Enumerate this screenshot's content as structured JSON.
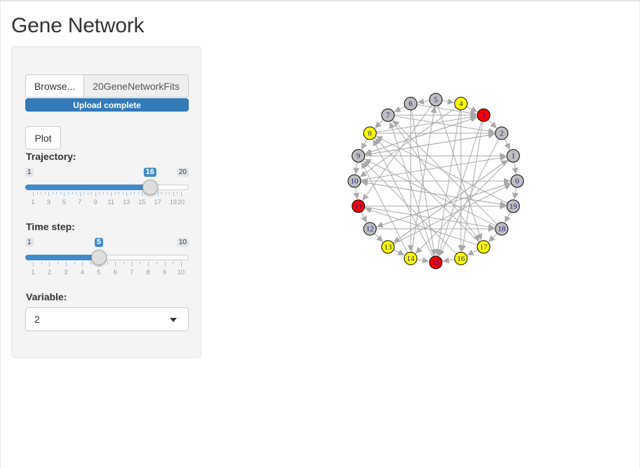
{
  "app_title": "Gene Network",
  "sidebar": {
    "file_input": {
      "browse_label": "Browse...",
      "file_name": "20GeneNetworkFits",
      "upload_status": "Upload complete",
      "upload_progress_percent": 100
    },
    "plot_button_label": "Plot",
    "trajectory": {
      "label": "Trajectory:",
      "min": 1,
      "max": 20,
      "value": 16,
      "min_label": "1",
      "max_label": "20",
      "value_label": "16",
      "tick_labels": [
        "1",
        "3",
        "5",
        "7",
        "9",
        "11",
        "13",
        "15",
        "17",
        "19",
        "20"
      ],
      "tick_values": [
        1,
        3,
        5,
        7,
        9,
        11,
        13,
        15,
        17,
        19,
        20
      ]
    },
    "time_step": {
      "label": "Time step:",
      "min": 1,
      "max": 10,
      "value": 5,
      "min_label": "1",
      "max_label": "10",
      "value_label": "5",
      "tick_labels": [
        "1",
        "2",
        "3",
        "4",
        "5",
        "6",
        "7",
        "8",
        "9",
        "10"
      ],
      "tick_values": [
        1,
        2,
        3,
        4,
        5,
        6,
        7,
        8,
        9,
        10
      ]
    },
    "variable": {
      "label": "Variable:",
      "selected": "2"
    }
  },
  "network": {
    "colors": {
      "gray": "#bebebe",
      "yellow": "#ffff00",
      "red": "#ff0000",
      "edge": "#a9a9a9",
      "label": "#1a1a8c"
    },
    "nodes": [
      {
        "id": "0",
        "color": "gray"
      },
      {
        "id": "1",
        "color": "gray"
      },
      {
        "id": "2",
        "color": "gray"
      },
      {
        "id": "3",
        "color": "red"
      },
      {
        "id": "4",
        "color": "yellow"
      },
      {
        "id": "5",
        "color": "gray"
      },
      {
        "id": "6",
        "color": "gray"
      },
      {
        "id": "7",
        "color": "gray"
      },
      {
        "id": "8",
        "color": "yellow"
      },
      {
        "id": "9",
        "color": "gray"
      },
      {
        "id": "10",
        "color": "gray"
      },
      {
        "id": "11",
        "color": "red"
      },
      {
        "id": "12",
        "color": "gray"
      },
      {
        "id": "13",
        "color": "yellow"
      },
      {
        "id": "14",
        "color": "yellow"
      },
      {
        "id": "15",
        "color": "red"
      },
      {
        "id": "16",
        "color": "yellow"
      },
      {
        "id": "17",
        "color": "yellow"
      },
      {
        "id": "18",
        "color": "gray"
      },
      {
        "id": "19",
        "color": "gray"
      }
    ],
    "edges": [
      [
        5,
        4
      ],
      [
        4,
        3
      ],
      [
        3,
        2
      ],
      [
        2,
        1
      ],
      [
        1,
        0
      ],
      [
        0,
        19
      ],
      [
        19,
        18
      ],
      [
        18,
        17
      ],
      [
        17,
        16
      ],
      [
        16,
        15
      ],
      [
        14,
        15
      ],
      [
        13,
        14
      ],
      [
        12,
        13
      ],
      [
        11,
        12
      ],
      [
        10,
        11
      ],
      [
        9,
        10
      ],
      [
        8,
        9
      ],
      [
        7,
        8
      ],
      [
        6,
        7
      ],
      [
        5,
        6
      ],
      [
        9,
        1
      ],
      [
        9,
        3
      ],
      [
        9,
        2
      ],
      [
        8,
        3
      ],
      [
        8,
        2
      ],
      [
        7,
        2
      ],
      [
        7,
        3
      ],
      [
        6,
        3
      ],
      [
        6,
        15
      ],
      [
        5,
        17
      ],
      [
        4,
        16
      ],
      [
        4,
        15
      ],
      [
        3,
        15
      ],
      [
        3,
        16
      ],
      [
        2,
        15
      ],
      [
        1,
        14
      ],
      [
        1,
        13
      ],
      [
        0,
        10
      ],
      [
        0,
        12
      ],
      [
        10,
        0
      ],
      [
        10,
        19
      ],
      [
        10,
        1
      ],
      [
        11,
        19
      ],
      [
        11,
        18
      ],
      [
        12,
        18
      ],
      [
        12,
        0
      ],
      [
        13,
        1
      ],
      [
        13,
        0
      ],
      [
        14,
        5
      ],
      [
        14,
        9
      ],
      [
        15,
        7
      ],
      [
        15,
        8
      ],
      [
        16,
        9
      ],
      [
        17,
        8
      ],
      [
        17,
        11
      ],
      [
        18,
        9
      ],
      [
        18,
        7
      ],
      [
        19,
        10
      ],
      [
        19,
        8
      ],
      [
        2,
        9
      ],
      [
        3,
        9
      ],
      [
        4,
        10
      ],
      [
        5,
        11
      ],
      [
        6,
        14
      ],
      [
        7,
        17
      ]
    ]
  }
}
